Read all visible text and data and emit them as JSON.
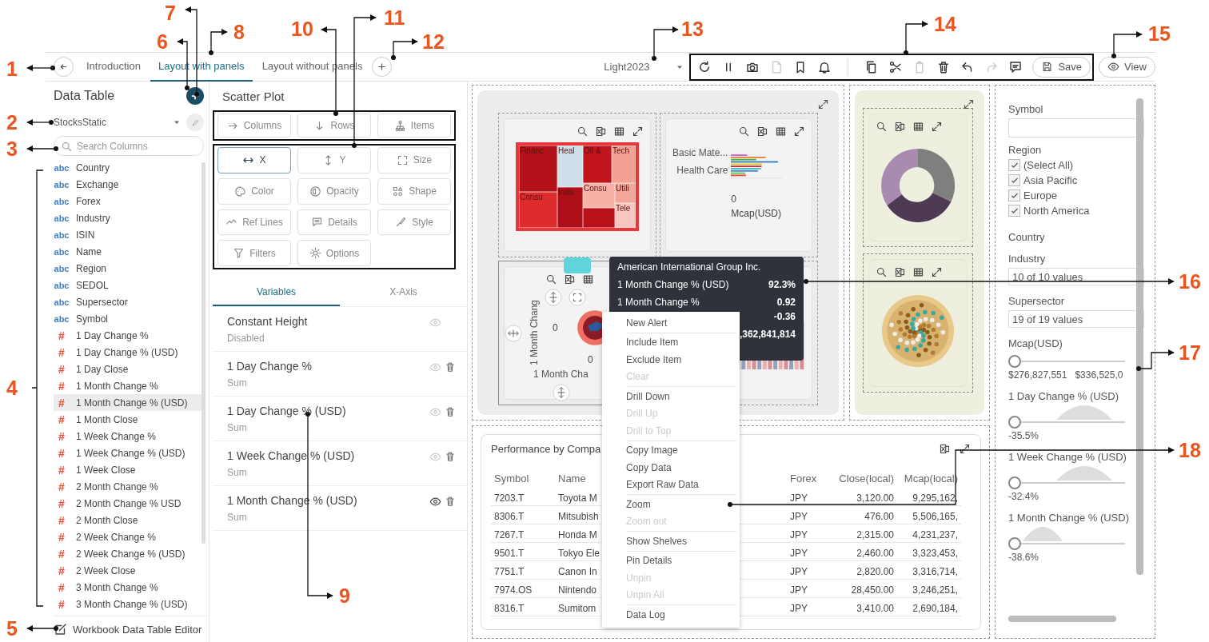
{
  "callouts": [
    "1",
    "2",
    "3",
    "4",
    "5",
    "6",
    "7",
    "8",
    "9",
    "10",
    "11",
    "12",
    "13",
    "14",
    "15",
    "16",
    "17",
    "18"
  ],
  "nav": {
    "tabs": [
      {
        "label": "Introduction",
        "selected": false
      },
      {
        "label": "Layout with panels",
        "selected": true
      },
      {
        "label": "Layout without panels",
        "selected": false
      }
    ]
  },
  "theme": "Light2023",
  "toolbar": {
    "tools": [
      {
        "kind": "refresh",
        "disabled": false
      },
      {
        "kind": "pause",
        "disabled": false
      },
      {
        "kind": "camera",
        "disabled": false
      },
      {
        "kind": "pdf",
        "disabled": true
      },
      {
        "kind": "bookmark",
        "disabled": false
      },
      {
        "kind": "bell",
        "disabled": false
      },
      {
        "kind": "separator"
      },
      {
        "kind": "copy",
        "disabled": false
      },
      {
        "kind": "cut",
        "disabled": false
      },
      {
        "kind": "paste",
        "disabled": true
      },
      {
        "kind": "trash",
        "disabled": false
      },
      {
        "kind": "undo",
        "disabled": false
      },
      {
        "kind": "redo",
        "disabled": true
      },
      {
        "kind": "comment",
        "disabled": false
      }
    ],
    "save": "Save"
  },
  "view": "View",
  "data_table": {
    "title": "Data Table",
    "source": "StocksStatic",
    "search_placeholder": "Search Columns",
    "columns": [
      {
        "kind": "text",
        "badge": "abc",
        "name": "Country",
        "selected": false
      },
      {
        "kind": "text",
        "badge": "abc",
        "name": "Exchange",
        "selected": false
      },
      {
        "kind": "text",
        "badge": "abc",
        "name": "Forex",
        "selected": false
      },
      {
        "kind": "text",
        "badge": "abc",
        "name": "Industry",
        "selected": false
      },
      {
        "kind": "text",
        "badge": "abc",
        "name": "ISIN",
        "selected": false
      },
      {
        "kind": "text",
        "badge": "abc",
        "name": "Name",
        "selected": false
      },
      {
        "kind": "text",
        "badge": "abc",
        "name": "Region",
        "selected": false
      },
      {
        "kind": "text",
        "badge": "abc",
        "name": "SEDOL",
        "selected": false
      },
      {
        "kind": "text",
        "badge": "abc",
        "name": "Supersector",
        "selected": false
      },
      {
        "kind": "text",
        "badge": "abc",
        "name": "Symbol",
        "selected": false
      },
      {
        "kind": "number",
        "badge": "#",
        "name": "1 Day Change %",
        "selected": false
      },
      {
        "kind": "number",
        "badge": "#",
        "name": "1 Day Change % (USD)",
        "selected": false
      },
      {
        "kind": "number",
        "badge": "#",
        "name": "1 Day Close",
        "selected": false
      },
      {
        "kind": "number",
        "badge": "#",
        "name": "1 Month Change %",
        "selected": false
      },
      {
        "kind": "number",
        "badge": "#",
        "name": "1 Month Change % (USD)",
        "selected": true
      },
      {
        "kind": "number",
        "badge": "#",
        "name": "1 Month Close",
        "selected": false
      },
      {
        "kind": "number",
        "badge": "#",
        "name": "1 Week Change %",
        "selected": false
      },
      {
        "kind": "number",
        "badge": "#",
        "name": "1 Week Change % (USD)",
        "selected": false
      },
      {
        "kind": "number",
        "badge": "#",
        "name": "1 Week Close",
        "selected": false
      },
      {
        "kind": "number",
        "badge": "#",
        "name": "2 Month Change %",
        "selected": false
      },
      {
        "kind": "number",
        "badge": "#",
        "name": "2 Month Change % USD",
        "selected": false
      },
      {
        "kind": "number",
        "badge": "#",
        "name": "2 Month Close",
        "selected": false
      },
      {
        "kind": "number",
        "badge": "#",
        "name": "2 Week Change %",
        "selected": false
      },
      {
        "kind": "number",
        "badge": "#",
        "name": "2 Week Change % (USD)",
        "selected": false
      },
      {
        "kind": "number",
        "badge": "#",
        "name": "2 Week Close",
        "selected": false
      },
      {
        "kind": "number",
        "badge": "#",
        "name": "3 Month Change %",
        "selected": false
      },
      {
        "kind": "number",
        "badge": "#",
        "name": "3 Month Change % (USD)",
        "selected": false
      }
    ],
    "footer": "Workbook Data Table Editor"
  },
  "scatter_plot": {
    "title": "Scatter Plot",
    "shelves": [
      {
        "kind": "columns",
        "label": "Columns"
      },
      {
        "kind": "rows",
        "label": "Rows"
      },
      {
        "kind": "items",
        "label": "Items"
      }
    ],
    "properties": [
      {
        "kind": "x",
        "label": "X",
        "selected": true
      },
      {
        "kind": "y",
        "label": "Y",
        "selected": false
      },
      {
        "kind": "size",
        "label": "Size",
        "selected": false
      },
      {
        "kind": "color",
        "label": "Color",
        "selected": false
      },
      {
        "kind": "opacity",
        "label": "Opacity",
        "selected": false
      },
      {
        "kind": "shape",
        "label": "Shape",
        "selected": false
      },
      {
        "kind": "reflines",
        "label": "Ref Lines",
        "selected": false
      },
      {
        "kind": "details",
        "label": "Details",
        "selected": false
      },
      {
        "kind": "style",
        "label": "Style",
        "selected": false
      },
      {
        "kind": "filters",
        "label": "Filters",
        "selected": false
      },
      {
        "kind": "options",
        "label": "Options",
        "selected": false
      }
    ],
    "tabs": [
      {
        "label": "Variables",
        "selected": true
      },
      {
        "label": "X-Axis",
        "selected": false
      }
    ],
    "variables": [
      {
        "name": "Constant Height",
        "sub": "Disabled",
        "visible": false,
        "deletable": false
      },
      {
        "name": "1 Day Change %",
        "sub": "Sum",
        "visible": false,
        "deletable": true
      },
      {
        "name": "1 Day Change % (USD)",
        "sub": "Sum",
        "visible": false,
        "deletable": true
      },
      {
        "name": "1 Week Change % (USD)",
        "sub": "Sum",
        "visible": false,
        "deletable": true
      },
      {
        "name": "1 Month Change % (USD)",
        "sub": "Sum",
        "visible": true,
        "deletable": true
      }
    ]
  },
  "dashboard": {
    "treemap": {
      "cells": [
        {
          "label": "Financ",
          "color": "#b3121b"
        },
        {
          "label": "Heal",
          "color": "#cfe0ea"
        },
        {
          "label": "Oil &",
          "color": "#c2141d"
        },
        {
          "label": "Tech",
          "color": "#f4a194"
        },
        {
          "label": "Consu",
          "color": "#de2c2c"
        },
        {
          "label": "Indu",
          "color": "#ae0f18"
        },
        {
          "label": "Consu",
          "color": "#f6b2a6"
        },
        {
          "label": "Utili",
          "color": "#f4a699"
        },
        {
          "label": "Tele",
          "color": "#f8c6bb"
        }
      ]
    },
    "bar_chart": {
      "categories": [
        "Basic Mate...",
        "Health Care"
      ],
      "tick": "0",
      "axis_title": "Mcap(USD)"
    },
    "scatter": {
      "y_title": "1 Month Chang",
      "x_title": "1 Month Cha",
      "y_tick": "0",
      "x_tick": "0"
    },
    "tooltip": {
      "title": "American International Group Inc.",
      "rows": [
        {
          "label": "1 Month Change % (USD)",
          "value": "92.3%"
        },
        {
          "label": "1 Month Change %",
          "value": "0.92"
        },
        {
          "label": "",
          "value": "-0.36"
        },
        {
          "label": "",
          "value": ",362,841,814"
        }
      ]
    },
    "menu": {
      "groups": [
        {
          "items": [
            {
              "label": "New Alert",
              "disabled": false
            }
          ]
        },
        {
          "items": [
            {
              "label": "Include Item",
              "disabled": false
            },
            {
              "label": "Exclude Item",
              "disabled": false
            },
            {
              "label": "Clear",
              "disabled": true
            }
          ]
        },
        {
          "items": [
            {
              "label": "Drill Down",
              "disabled": false
            },
            {
              "label": "Drill Up",
              "disabled": true
            },
            {
              "label": "Drill to Top",
              "disabled": true
            }
          ]
        },
        {
          "items": [
            {
              "label": "Copy Image",
              "disabled": false
            },
            {
              "label": "Copy Data",
              "disabled": false
            },
            {
              "label": "Export Raw Data",
              "disabled": false
            }
          ]
        },
        {
          "items": [
            {
              "label": "Zoom",
              "disabled": false
            },
            {
              "label": "Zoom out",
              "disabled": true
            }
          ]
        },
        {
          "items": [
            {
              "label": "Show Shelves",
              "disabled": false
            }
          ]
        },
        {
          "items": [
            {
              "label": "Pin Details",
              "disabled": false
            },
            {
              "label": "Unpin",
              "disabled": true
            },
            {
              "label": "Unpin All",
              "disabled": true
            }
          ]
        },
        {
          "items": [
            {
              "label": "Data Log",
              "disabled": false
            }
          ]
        }
      ]
    },
    "table": {
      "title": "Performance by Compa",
      "columns": [
        "Symbol",
        "Name",
        "Forex",
        "Close(local)",
        "Mcap(local)"
      ],
      "rows": [
        [
          "7203.T",
          "Toyota M",
          "JPY",
          "3,120.00",
          "9,295,162,"
        ],
        [
          "8306.T",
          "Mitsubish",
          "JPY",
          "476.00",
          "5,506,165,"
        ],
        [
          "7267.T",
          "Honda M",
          "JPY",
          "2,315.00",
          "4,231,237,"
        ],
        [
          "9501.T",
          "Tokyo Ele",
          "JPY",
          "2,460.00",
          "3,323,453,"
        ],
        [
          "7751.T",
          "Canon In",
          "JPY",
          "2,820.00",
          "3,316,714,"
        ],
        [
          "7974.OS",
          "Nintendo",
          "JPY",
          "28,450.00",
          "3,246,251,"
        ],
        [
          "8316.T",
          "Sumitom",
          "JPY",
          "3,410.00",
          "2,690,184,"
        ]
      ]
    },
    "filters": [
      {
        "kind": "text",
        "label": "Symbol"
      },
      {
        "kind": "checklist",
        "label": "Region",
        "options": [
          {
            "label": "(Select All)",
            "checked": true
          },
          {
            "label": "Asia Pacific",
            "checked": true
          },
          {
            "label": "Europe",
            "checked": true
          },
          {
            "label": "North America",
            "checked": true
          }
        ]
      },
      {
        "kind": "heading",
        "label": "Country"
      },
      {
        "kind": "select",
        "label": "Industry",
        "value": "10 of 10 values"
      },
      {
        "kind": "select",
        "label": "Supersector",
        "value": "19 of 19 values"
      },
      {
        "kind": "range",
        "label": "Mcap(USD)",
        "level": 0,
        "min": "$276,827,551",
        "max": "$336,525,0"
      },
      {
        "kind": "slider",
        "label": "1 Day Change % (USD)",
        "level": 0,
        "reading": "-35.5%"
      },
      {
        "kind": "slider",
        "label": "1 Week Change % (USD)",
        "level": 0,
        "reading": "-32.4%"
      },
      {
        "kind": "slider",
        "label": "1 Month Change % (USD)",
        "level": 0,
        "reading": "-38.6%"
      }
    ]
  }
}
